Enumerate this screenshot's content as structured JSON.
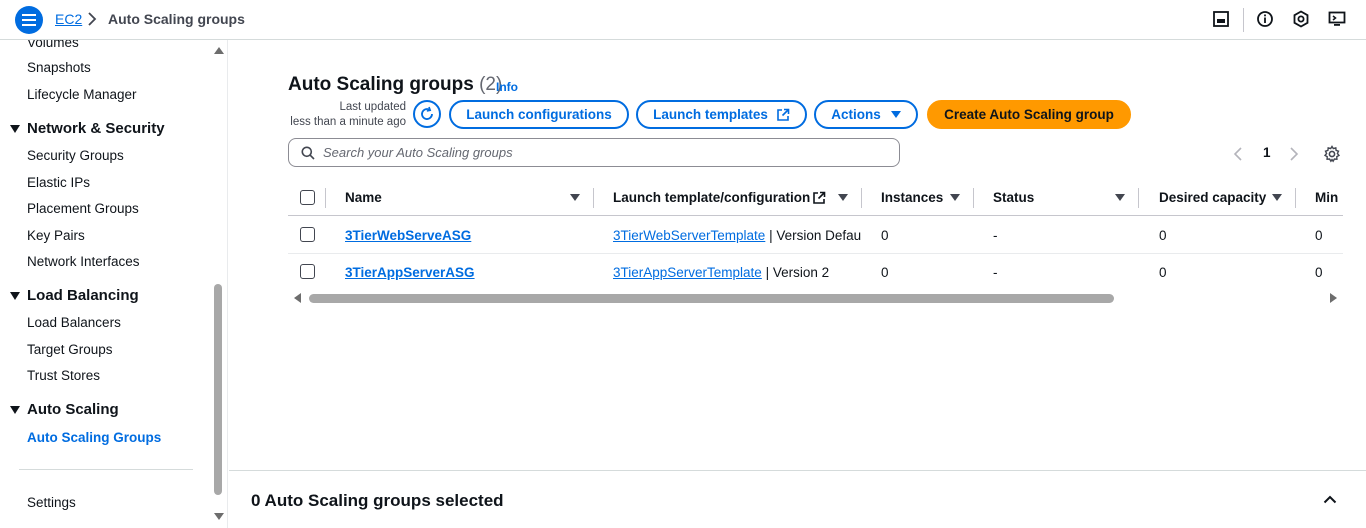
{
  "breadcrumb": {
    "root": "EC2",
    "current": "Auto Scaling groups"
  },
  "topbar_icons": [
    "panel-icon",
    "info-icon",
    "notifications-icon",
    "cloudshell-icon"
  ],
  "sidebar": {
    "items": [
      {
        "label": "Volumes",
        "type": "link"
      },
      {
        "label": "Snapshots",
        "type": "link"
      },
      {
        "label": "Lifecycle Manager",
        "type": "link"
      },
      {
        "label": "Network & Security",
        "type": "section"
      },
      {
        "label": "Security Groups",
        "type": "link"
      },
      {
        "label": "Elastic IPs",
        "type": "link"
      },
      {
        "label": "Placement Groups",
        "type": "link"
      },
      {
        "label": "Key Pairs",
        "type": "link"
      },
      {
        "label": "Network Interfaces",
        "type": "link"
      },
      {
        "label": "Load Balancing",
        "type": "section"
      },
      {
        "label": "Load Balancers",
        "type": "link"
      },
      {
        "label": "Target Groups",
        "type": "link"
      },
      {
        "label": "Trust Stores",
        "type": "link"
      },
      {
        "label": "Auto Scaling",
        "type": "section"
      },
      {
        "label": "Auto Scaling Groups",
        "type": "link",
        "active": true
      },
      {
        "label": "Settings",
        "type": "link"
      }
    ]
  },
  "main": {
    "title": "Auto Scaling groups",
    "count": "(2)",
    "info": "Info",
    "last_updated_line1": "Last updated",
    "last_updated_line2": "less than a minute ago",
    "buttons": {
      "launch_configurations": "Launch configurations",
      "launch_templates": "Launch templates",
      "actions": "Actions",
      "create": "Create Auto Scaling group"
    },
    "search": {
      "placeholder": "Search your Auto Scaling groups",
      "value": ""
    },
    "pagination": {
      "current_page": "1"
    }
  },
  "table": {
    "columns": [
      "Name",
      "Launch template/configuration",
      "Instances",
      "Status",
      "Desired capacity",
      "Min"
    ],
    "rows": [
      {
        "name": "3TierWebServeASG",
        "template_link": "3TierWebServerTemplate",
        "template_version": " | Version Default",
        "instances": "0",
        "status": "-",
        "desired": "0",
        "min": "0"
      },
      {
        "name": "3TierAppServerASG",
        "template_link": "3TierAppServerTemplate",
        "template_version": " | Version 2",
        "instances": "0",
        "status": "-",
        "desired": "0",
        "min": "0"
      }
    ]
  },
  "bottom_panel": {
    "title": "0 Auto Scaling groups selected"
  },
  "colors": {
    "accent": "#006ce0",
    "primary_button": "#ff9900",
    "text": "#0f141a"
  }
}
